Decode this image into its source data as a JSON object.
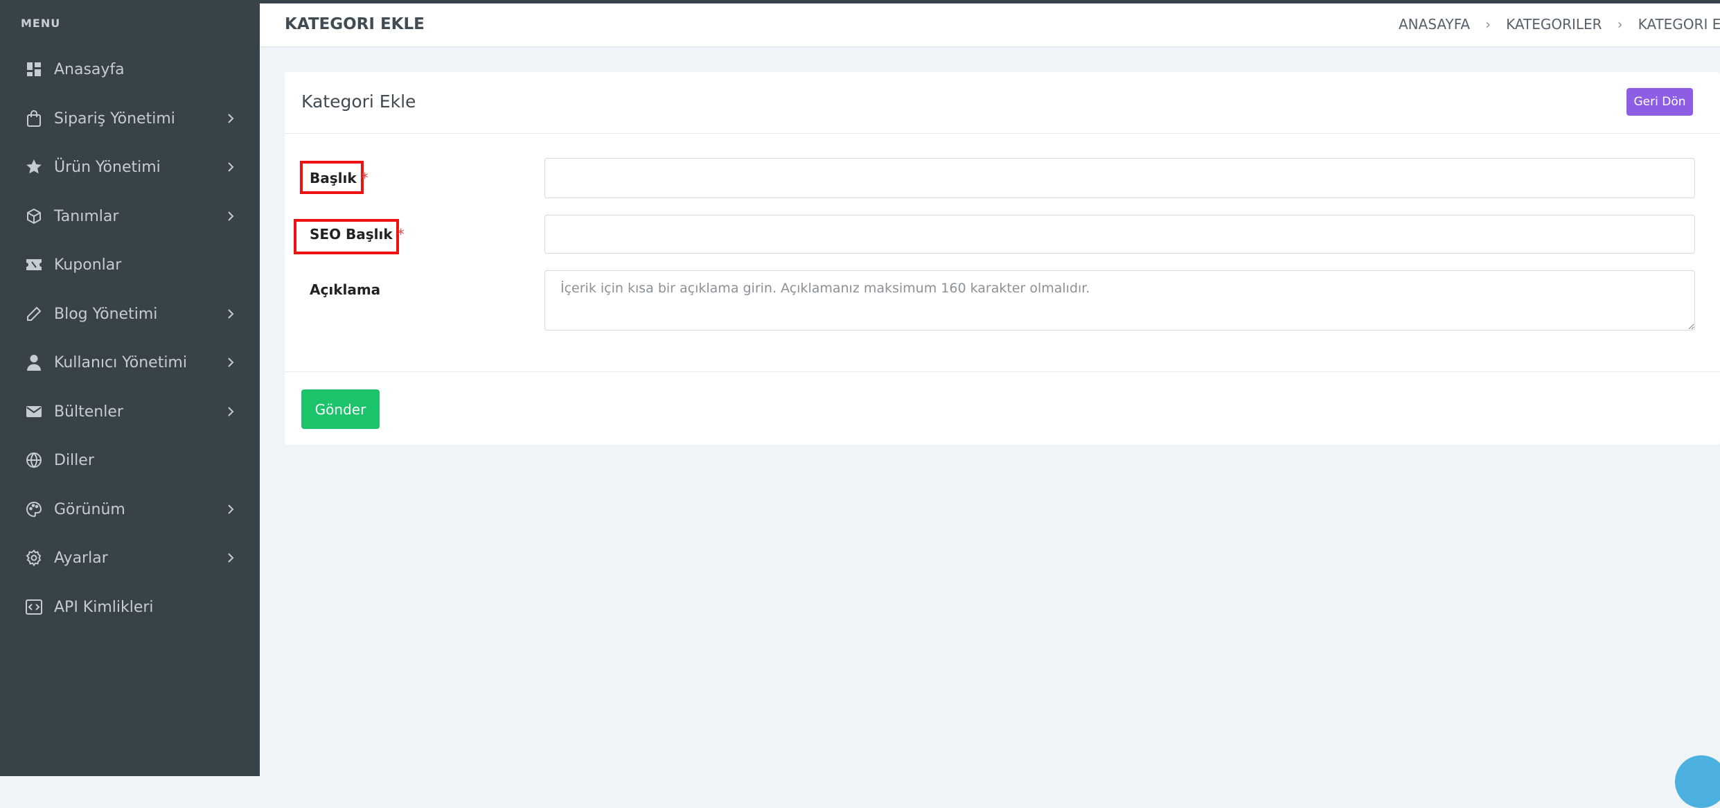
{
  "sidebar": {
    "heading": "MENU",
    "items": [
      {
        "label": "Anasayfa",
        "icon": "dashboard-icon",
        "has_submenu": false
      },
      {
        "label": "Sipariş Yönetimi",
        "icon": "shopping-bag-icon",
        "has_submenu": true
      },
      {
        "label": "Ürün Yönetimi",
        "icon": "star-icon",
        "has_submenu": true
      },
      {
        "label": "Tanımlar",
        "icon": "box-icon",
        "has_submenu": true
      },
      {
        "label": "Kuponlar",
        "icon": "ticket-icon",
        "has_submenu": false
      },
      {
        "label": "Blog Yönetimi",
        "icon": "pencil-icon",
        "has_submenu": true
      },
      {
        "label": "Kullanıcı Yönetimi",
        "icon": "user-icon",
        "has_submenu": true
      },
      {
        "label": "Bültenler",
        "icon": "mail-icon",
        "has_submenu": true
      },
      {
        "label": "Diller",
        "icon": "globe-icon",
        "has_submenu": false
      },
      {
        "label": "Görünüm",
        "icon": "palette-icon",
        "has_submenu": true
      },
      {
        "label": "Ayarlar",
        "icon": "gear-icon",
        "has_submenu": true
      },
      {
        "label": "API Kimlikleri",
        "icon": "code-icon",
        "has_submenu": false
      }
    ]
  },
  "header": {
    "title": "KATEGORI EKLE",
    "breadcrumb": [
      "ANASAYFA",
      "KATEGORILER",
      "KATEGORI EKLE"
    ]
  },
  "card": {
    "title": "Kategori Ekle",
    "back_button": "Geri Dön",
    "fields": {
      "title": {
        "label": "Başlık",
        "required_mark": "*",
        "value": ""
      },
      "seo_title": {
        "label": "SEO Başlık",
        "required_mark": "*",
        "value": ""
      },
      "description": {
        "label": "Açıklama",
        "value": "",
        "placeholder": "İçerik için kısa bir açıklama girin. Açıklamanız maksimum 160 karakter olmalıdır."
      }
    },
    "submit_button": "Gönder"
  },
  "colors": {
    "sidebar_bg": "#384249",
    "back_button": "#8d5ee3",
    "submit_button": "#1bc46b",
    "highlight": "#ee1111"
  }
}
